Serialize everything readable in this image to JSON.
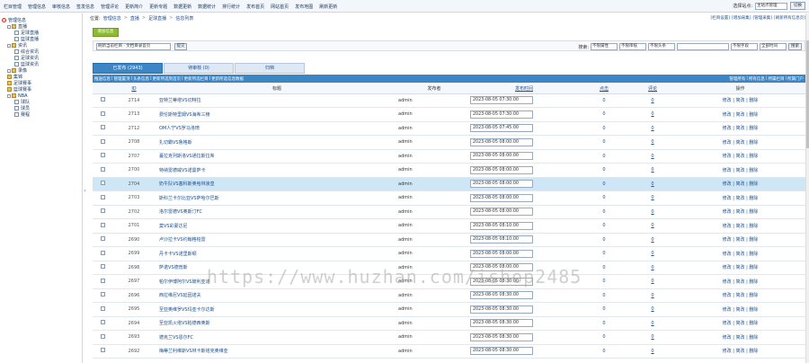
{
  "topnav": [
    "栏目管理",
    "管理信息",
    "审核信息",
    "签发信息",
    "管理评论",
    "更新简介",
    "更新专题",
    "数据更新",
    "数据统计",
    "排行统计",
    "发布首页",
    "网站首页",
    "发布地图",
    "刷新更新"
  ],
  "top_right": {
    "label": "选择站点:",
    "select": "主站点管理",
    "button": "切换"
  },
  "sidebar": [
    {
      "label": "管理信息",
      "level": 0,
      "icon": "gear-icon",
      "pm": false
    },
    {
      "label": "直播",
      "level": 1,
      "icon": "folder-icon",
      "pm": true
    },
    {
      "label": "足球直播",
      "level": 2,
      "icon": "page-icon",
      "pm": false
    },
    {
      "label": "篮球直播",
      "level": 2,
      "icon": "page-icon",
      "pm": false
    },
    {
      "label": "资讯",
      "level": 1,
      "icon": "folder-icon",
      "pm": true
    },
    {
      "label": "综合资讯",
      "level": 2,
      "icon": "page-icon",
      "pm": false
    },
    {
      "label": "足球资讯",
      "level": 2,
      "icon": "page-icon",
      "pm": false
    },
    {
      "label": "篮球资讯",
      "level": 2,
      "icon": "page-icon",
      "pm": false
    },
    {
      "label": "录像",
      "level": 1,
      "icon": "folder-icon",
      "pm": true
    },
    {
      "label": "集锦",
      "level": 1,
      "icon": "folder-icon",
      "pm": false
    },
    {
      "label": "足球赛事",
      "level": 1,
      "icon": "folder-icon",
      "pm": false
    },
    {
      "label": "篮球赛事",
      "level": 1,
      "icon": "folder-icon",
      "pm": false
    },
    {
      "label": "NBA",
      "level": 1,
      "icon": "folder-icon",
      "pm": true
    },
    {
      "label": "球队",
      "level": 2,
      "icon": "page-icon",
      "pm": false
    },
    {
      "label": "球员",
      "level": 2,
      "icon": "page-icon",
      "pm": false
    },
    {
      "label": "赛程",
      "level": 2,
      "icon": "page-icon",
      "pm": false
    }
  ],
  "breadcrumb": {
    "prefix": "位置:",
    "items": [
      "管理信息",
      "直播",
      "足球直播",
      "信息列表"
    ]
  },
  "crumb_links": [
    "[栏目设置]",
    "[增加采集]",
    "[管理采集]",
    "[刷新所有信息页]"
  ],
  "add_button": "增加信息",
  "filter": {
    "select": "刷新当前栏目 · 文档目录首页",
    "submit": "提交",
    "search_label": "搜索:",
    "selects": [
      "不限属性",
      "不限审核",
      "不限头条"
    ],
    "sort_select": "不限字段",
    "scope_select": "全部时间",
    "search_button": "搜索"
  },
  "tabs": [
    {
      "label": "已发布 (2943)",
      "active": true
    },
    {
      "label": "待审核 (0)",
      "active": false
    },
    {
      "label": "归档",
      "active": false
    }
  ],
  "actbar_left": [
    "推送信息",
    "管理置顶",
    "头条信息",
    "更新所选到首页",
    "更新所选栏目",
    "更新所选信息数据"
  ],
  "actbar_right": [
    "管理所有",
    "所有信息",
    "所属栏目",
    "所属门户"
  ],
  "columns": {
    "id": "ID",
    "title": "标题",
    "author": "发布者",
    "date": "发布时间",
    "clicks": "点击",
    "comments": "评论",
    "ops": "操作"
  },
  "ops_label": "修改 | 简改 | 删除",
  "rows": [
    {
      "id": "2714",
      "title": "亚特兰蒂塔VS切特拉",
      "author": "admin",
      "date": "2023-08-05 07:30:00",
      "clicks": "0",
      "comments": "0",
      "hl": false
    },
    {
      "id": "2713",
      "title": "费伦斯特里姆VS海希三棱",
      "author": "admin",
      "date": "2023-08-05 07:30:00",
      "clicks": "0",
      "comments": "0",
      "hl": false
    },
    {
      "id": "2712",
      "title": "OM人宁VS罗马洛琦",
      "author": "admin",
      "date": "2023-08-05 07:45:00",
      "clicks": "0",
      "comments": "0",
      "hl": false
    },
    {
      "id": "2708",
      "title": "扎切霸VS鲁格斯",
      "author": "admin",
      "date": "2023-08-05 08:00:00",
      "clicks": "0",
      "comments": "0",
      "hl": false
    },
    {
      "id": "2707",
      "title": "蔓拉克列斯洛VS通拉斯拉希",
      "author": "admin",
      "date": "2023-08-05 08:00:00",
      "clicks": "0",
      "comments": "0",
      "hl": false
    },
    {
      "id": "2700",
      "title": "特纳雷德威VS诺曼萨卡",
      "author": "admin",
      "date": "2023-08-05 08:00:00",
      "clicks": "0",
      "comments": "0",
      "hl": false
    },
    {
      "id": "2704",
      "title": "奶牛队VS塞科斯奥哈林浪皇",
      "author": "admin",
      "date": "2023-08-05 08:00:00",
      "clicks": "0",
      "comments": "0",
      "hl": true
    },
    {
      "id": "2703",
      "title": "斯科兰卡尔比亚VS萨哈尔巴斯",
      "author": "admin",
      "date": "2023-08-05 08:00:00",
      "clicks": "0",
      "comments": "0",
      "hl": false
    },
    {
      "id": "2702",
      "title": "洛尔雷德VS奥斯汀FC",
      "author": "admin",
      "date": "2023-08-05 08:00:00",
      "clicks": "0",
      "comments": "0",
      "hl": false
    },
    {
      "id": "2701",
      "title": "莫VS彩蒙达尼",
      "author": "admin",
      "date": "2023-08-05 08:10:00",
      "clicks": "0",
      "comments": "0",
      "hl": false
    },
    {
      "id": "2690",
      "title": "卢沙拉卡VS约翰格帕雷",
      "author": "admin",
      "date": "2023-08-05 08:10:00",
      "clicks": "0",
      "comments": "0",
      "hl": false
    },
    {
      "id": "2699",
      "title": "丹卡卡VS诺里斯顿",
      "author": "admin",
      "date": "2023-08-05 08:00:00",
      "clicks": "0",
      "comments": "0",
      "hl": false
    },
    {
      "id": "2698",
      "title": "萨诺VS德普斯",
      "author": "admin",
      "date": "2023-08-05 08:00:00",
      "clicks": "0",
      "comments": "0",
      "hl": false
    },
    {
      "id": "2697",
      "title": "帕尔伊博阿尔VS玻利亚诺",
      "author": "admin",
      "date": "2023-08-05 08:30:00",
      "clicks": "0",
      "comments": "0",
      "hl": false
    },
    {
      "id": "2696",
      "title": "西拉维尼VS延因诺夫",
      "author": "admin",
      "date": "2023-08-05 08:30:00",
      "clicks": "0",
      "comments": "0",
      "hl": false
    },
    {
      "id": "2695",
      "title": "至亚奥维罗VS玛亚卡尔达斯",
      "author": "admin",
      "date": "2023-08-05 08:30:00",
      "clicks": "0",
      "comments": "0",
      "hl": false
    },
    {
      "id": "2694",
      "title": "至亚凯火塔VS柏德西奥斯",
      "author": "admin",
      "date": "2023-08-05 08:30:00",
      "clicks": "0",
      "comments": "0",
      "hl": false
    },
    {
      "id": "2693",
      "title": "德克兰VS恩尔FC",
      "author": "admin",
      "date": "2023-08-05 08:30:00",
      "clicks": "0",
      "comments": "0",
      "hl": false
    },
    {
      "id": "2692",
      "title": "梅蒂兰利维斯VS林卡斯塔克奥维亚",
      "author": "admin",
      "date": "2023-08-05 08:30:00",
      "clicks": "0",
      "comments": "0",
      "hl": false
    }
  ],
  "watermark": "https://www.huzhan.com/ishop2485"
}
